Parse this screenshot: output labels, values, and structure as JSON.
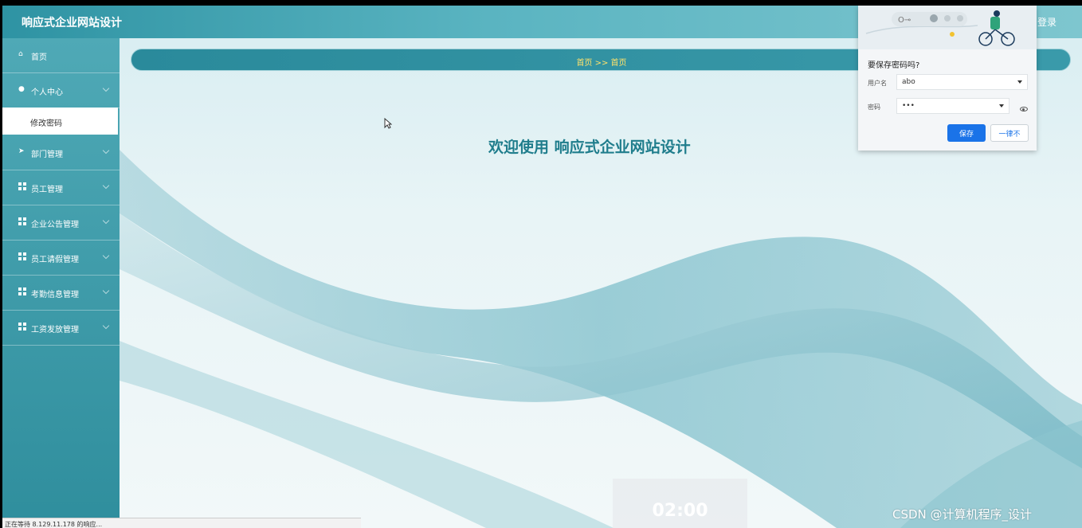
{
  "header": {
    "brand": "响应式企业网站设计",
    "logout": "退出登录"
  },
  "sidebar": {
    "items": [
      {
        "label": "首页",
        "icon": "home-icon"
      },
      {
        "label": "个人中心",
        "icon": "user-icon"
      },
      {
        "label": "部门管理",
        "icon": "send-icon"
      },
      {
        "label": "员工管理",
        "icon": "grid-icon"
      },
      {
        "label": "企业公告管理",
        "icon": "grid-icon"
      },
      {
        "label": "员工请假管理",
        "icon": "grid-icon"
      },
      {
        "label": "考勤信息管理",
        "icon": "grid-icon"
      },
      {
        "label": "工资发放管理",
        "icon": "grid-icon"
      }
    ],
    "sub_item": "修改密码"
  },
  "breadcrumb": "首页 >> 首页",
  "welcome": "欢迎使用 响应式企业网站设计",
  "password_popup": {
    "title": "要保存密码吗?",
    "username_label": "用户名",
    "username_value": "abo",
    "password_label": "密码",
    "password_value": "•••",
    "save_label": "保存",
    "never_label": "一律不"
  },
  "statusbar": "正在等待 8.129.11.178 的响应...",
  "timer": "02:00",
  "watermark": "CSDN @计算机程序_设计",
  "colors": {
    "header": "#2e93a3",
    "sidebar": "#3f9dab",
    "breadcrumb_text": "#ffe36b",
    "welcome": "#1f7d8c",
    "save_button": "#1a73e8"
  }
}
